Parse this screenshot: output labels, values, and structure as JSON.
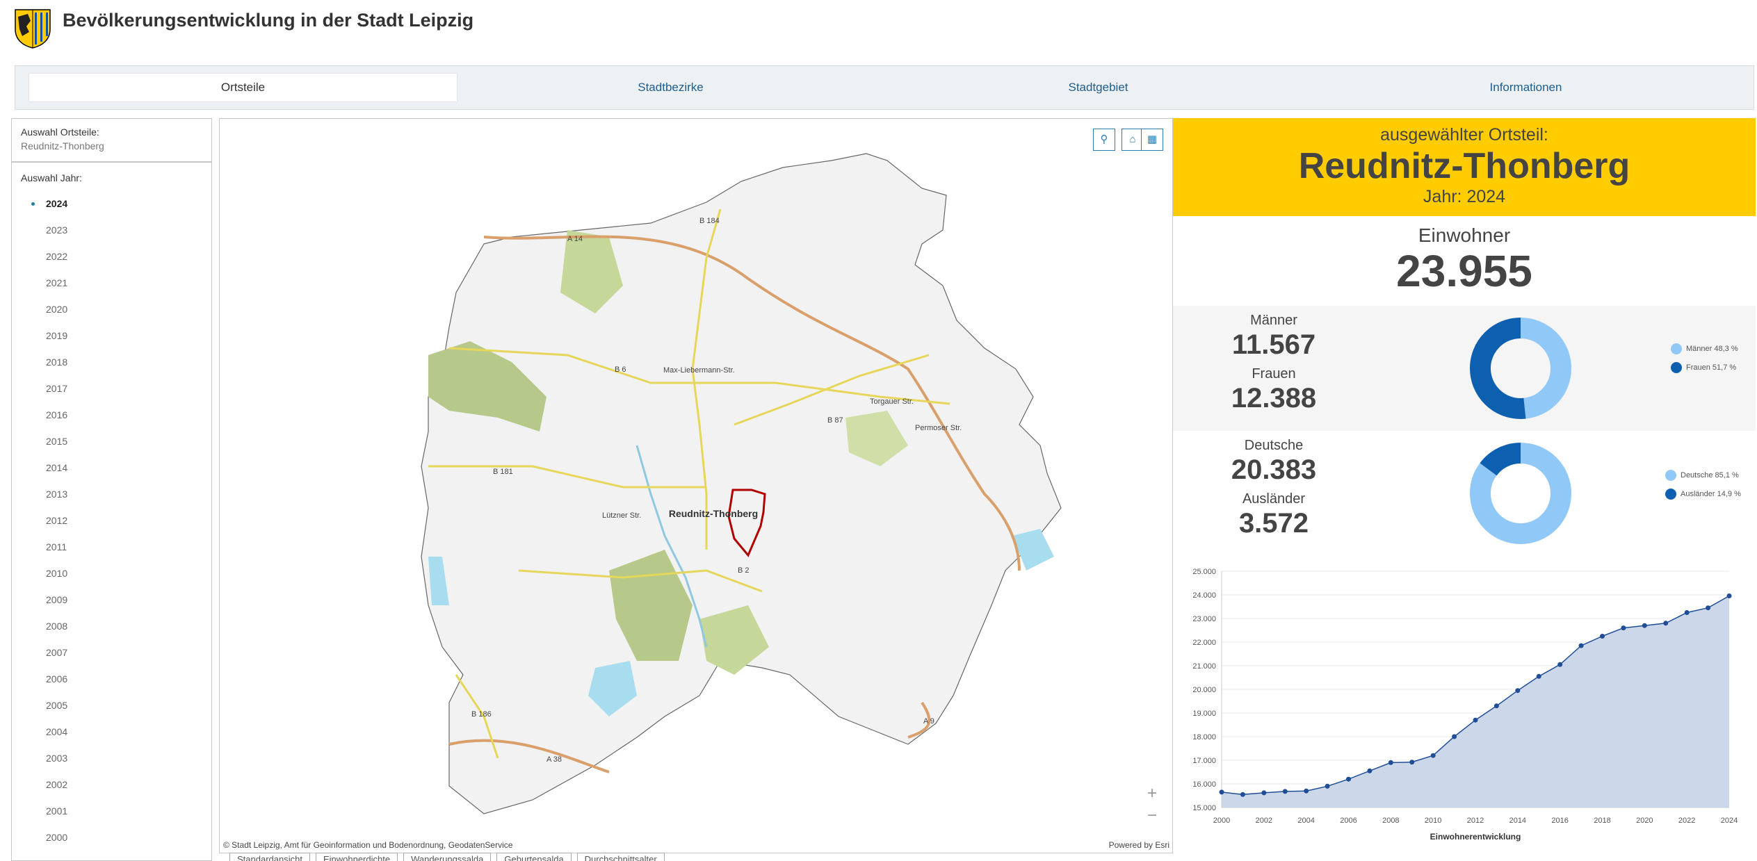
{
  "app": {
    "title": "Bevölkerungsentwicklung in der Stadt Leipzig"
  },
  "tabs": [
    {
      "label": "Ortsteile",
      "active": true
    },
    {
      "label": "Stadtbezirke",
      "active": false
    },
    {
      "label": "Stadtgebiet",
      "active": false
    },
    {
      "label": "Informationen",
      "active": false
    }
  ],
  "sidebar": {
    "ortsteil_label": "Auswahl Ortsteile:",
    "ortsteil_value": "Reudnitz-Thonberg",
    "year_label": "Auswahl Jahr:",
    "selected_year": "2024",
    "years": [
      "2024",
      "2023",
      "2022",
      "2021",
      "2020",
      "2019",
      "2018",
      "2017",
      "2016",
      "2015",
      "2014",
      "2013",
      "2012",
      "2011",
      "2010",
      "2009",
      "2008",
      "2007",
      "2006",
      "2005",
      "2004",
      "2003",
      "2002",
      "2001",
      "2000"
    ]
  },
  "map": {
    "selected_label": "Reudnitz-Thonberg",
    "road_labels": [
      "A 14",
      "B 184",
      "B 2",
      "B 6",
      "Max-Liebermann-Str.",
      "B 87",
      "Torgauer Str.",
      "Permoser Str.",
      "B 181",
      "Lützner Str.",
      "B 186",
      "A 38",
      "A 9"
    ],
    "tool_icons": [
      "search-icon",
      "home-icon",
      "basemap-gallery-icon"
    ],
    "zoom_in": "+",
    "zoom_out": "−",
    "attribution": "© Stadt Leipzig, Amt für Geoinformation und Bodenordnung, GeodatenService",
    "powered": "Powered by Esri",
    "bottom_tabs": [
      "Standardansicht",
      "Einwohnerdichte",
      "Wanderungssalda",
      "Geburtensalda",
      "Durchschnittsalter"
    ]
  },
  "panel": {
    "selected_sub": "ausgewählter Ortsteil:",
    "selected_name": "Reudnitz-Thonberg",
    "year_text": "Jahr: 2024",
    "inhabitants_label": "Einwohner",
    "inhabitants_value": "23.955",
    "men_label": "Männer",
    "men_value": "11.567",
    "women_label": "Frauen",
    "women_value": "12.388",
    "germans_label": "Deutsche",
    "germans_value": "20.383",
    "foreigners_label": "Ausländer",
    "foreigners_value": "3.572",
    "gender_legend": [
      {
        "label": "Männer",
        "pct": "48,3 %",
        "value": 48.3,
        "color": "#90c8f8"
      },
      {
        "label": "Frauen",
        "pct": "51,7 %",
        "value": 51.7,
        "color": "#0d5fb0"
      }
    ],
    "nation_legend": [
      {
        "label": "Deutsche",
        "pct": "85,1 %",
        "value": 85.1,
        "color": "#90c8f8"
      },
      {
        "label": "Ausländer",
        "pct": "14,9 %",
        "value": 14.9,
        "color": "#0d5fb0"
      }
    ]
  },
  "colors": {
    "accent": "#ffcc00",
    "selected_boundary": "#b00000",
    "series": "#1f4e96",
    "area": "#c8d3e8"
  },
  "chart_data": {
    "type": "area",
    "title": "",
    "xlabel": "Einwohnerentwicklung",
    "ylabel": "",
    "x": [
      2000,
      2001,
      2002,
      2003,
      2004,
      2005,
      2006,
      2007,
      2008,
      2009,
      2010,
      2011,
      2012,
      2013,
      2014,
      2015,
      2016,
      2017,
      2018,
      2019,
      2020,
      2021,
      2022,
      2023,
      2024
    ],
    "values": [
      15650,
      15550,
      15620,
      15680,
      15700,
      15900,
      16200,
      16550,
      16900,
      16920,
      17200,
      18000,
      18700,
      19300,
      19950,
      20550,
      21050,
      21850,
      22250,
      22600,
      22700,
      22800,
      23250,
      23450,
      23955
    ],
    "ylim": [
      15000,
      25000
    ],
    "yticks": [
      "15.000",
      "16.000",
      "17.000",
      "18.000",
      "19.000",
      "20.000",
      "21.000",
      "22.000",
      "23.000",
      "24.000",
      "25.000"
    ],
    "xticks": [
      "2000",
      "2002",
      "2004",
      "2006",
      "2008",
      "2010",
      "2012",
      "2014",
      "2016",
      "2018",
      "2020",
      "2022",
      "2024"
    ],
    "grid": true
  }
}
